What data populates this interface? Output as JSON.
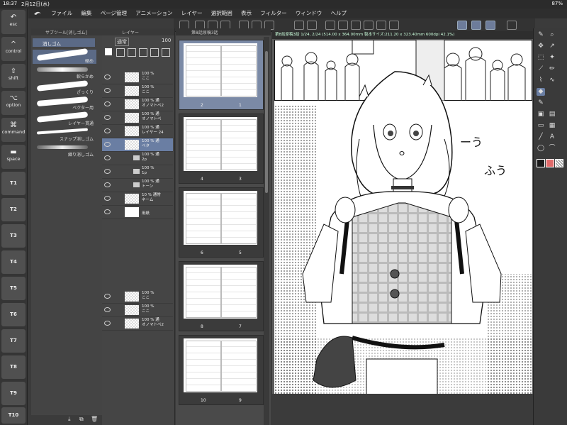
{
  "status": {
    "time": "18:37",
    "date": "2月12日(水)",
    "right": "87%"
  },
  "menu": {
    "items": [
      "ファイル",
      "編集",
      "ページ管理",
      "アニメーション",
      "レイヤー",
      "選択範囲",
      "表示",
      "フィルター",
      "ウィンドウ",
      "ヘルプ"
    ]
  },
  "modifiers": {
    "esc": "esc",
    "control": "control",
    "shift": "shift",
    "option": "option",
    "command": "command",
    "space": "space"
  },
  "tkeys": [
    "T1",
    "T2",
    "T3",
    "T4",
    "T5",
    "T6",
    "T7",
    "T8",
    "T9",
    "T10"
  ],
  "brush_panel": {
    "title": "サブツール[消しゴム]",
    "selected": "消しゴム",
    "brushes": [
      {
        "label": "硬め"
      },
      {
        "label": "軟らかめ"
      },
      {
        "label": "ざっくり"
      },
      {
        "label": "ベクター用"
      },
      {
        "label": "レイヤー貫通"
      },
      {
        "label": "スナップ消しゴム"
      },
      {
        "label": "練り消しゴム"
      }
    ]
  },
  "layer_panel": {
    "title": "レイヤー",
    "blend_mode": "通常",
    "opacity": "100",
    "layers": [
      {
        "line1": "100 %",
        "line2": "ここ"
      },
      {
        "line1": "100 %",
        "line2": "ここ"
      },
      {
        "line1": "100 % 通",
        "line2": "オノマトペ2"
      },
      {
        "line1": "100 % 通",
        "line2": "オノマトペ"
      },
      {
        "line1": "100 % 通",
        "line2": "レイヤー 24"
      },
      {
        "line1": "100 % 通",
        "line2": "ペタ"
      },
      {
        "line1": "100 % 通",
        "line2": "2p"
      },
      {
        "line1": "100 %",
        "line2": "1p"
      },
      {
        "line1": "100 % 通",
        "line2": "トーン"
      },
      {
        "line1": "10 % 通常",
        "line2": "ネーム"
      },
      {
        "line1": "",
        "line2": "用紙"
      },
      {
        "line1": "100 %",
        "line2": "ここ"
      },
      {
        "line1": "100 %",
        "line2": "ここ"
      },
      {
        "line1": "100 % 通",
        "line2": "オノマトペ2"
      }
    ]
  },
  "page_panel": {
    "title": "第8話原稿3話",
    "pages": [
      {
        "left": "2",
        "right": "1"
      },
      {
        "left": "4",
        "right": "3"
      },
      {
        "left": "6",
        "right": "5"
      },
      {
        "left": "8",
        "right": "7"
      },
      {
        "left": "10",
        "right": "9"
      }
    ]
  },
  "canvas": {
    "title": "第8話原稿3話 1/24, 2/24 (514.00 x 364.00mm 製本サイズ:211.20 x 323.40mm 600dpi 42.1%)",
    "sfx1": "ーう",
    "sfx2": "ふう"
  },
  "colors": {
    "main": "#1a1a1a",
    "sub": "#e06a6a",
    "accent": "#6a7ea3"
  }
}
